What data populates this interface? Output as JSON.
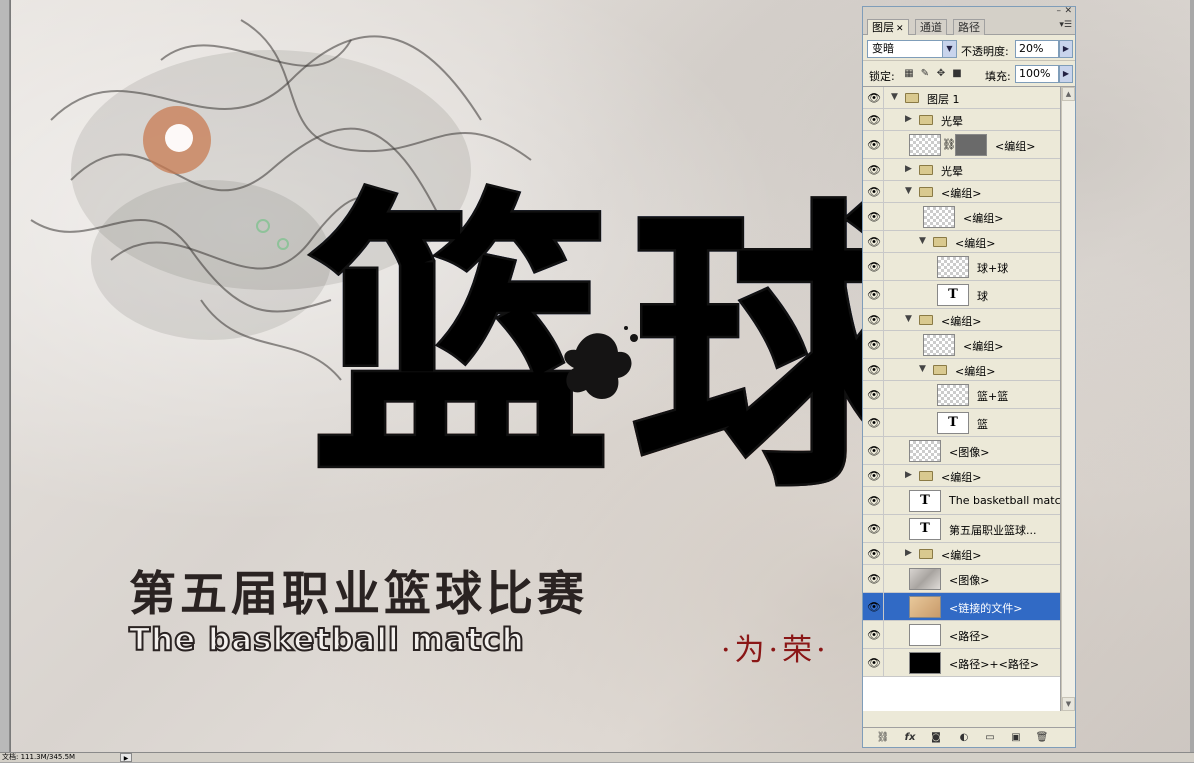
{
  "status_bar": {
    "text": "文档: 111.3M/345.5M"
  },
  "artwork": {
    "big_char_1": "篮",
    "big_char_2": "球",
    "headline_cn": "第五届职业篮球比赛",
    "headline_en": "The basketball match",
    "slogan": "·为·荣·"
  },
  "panel": {
    "tabs": [
      {
        "label": "图层"
      },
      {
        "label": "通道"
      },
      {
        "label": "路径"
      }
    ],
    "blend_mode": "变暗",
    "opacity_label": "不透明度:",
    "opacity_value": "20%",
    "lock_label": "锁定:",
    "fill_label": "填充:",
    "fill_value": "100%",
    "layers": [
      {
        "name": "图层 1",
        "kind": "group",
        "expanded": true
      },
      {
        "name": "光晕",
        "kind": "group",
        "expanded": false
      },
      {
        "name": "<编组>",
        "kind": "masked"
      },
      {
        "name": "光晕",
        "kind": "group",
        "expanded": false
      },
      {
        "name": "<编组>",
        "kind": "group",
        "expanded": true
      },
      {
        "name": "<编组>",
        "kind": "checker"
      },
      {
        "name": "<编组>",
        "kind": "group",
        "expanded": true
      },
      {
        "name": "球+球",
        "kind": "checker"
      },
      {
        "name": "球",
        "kind": "text"
      },
      {
        "name": "<编组>",
        "kind": "group",
        "expanded": true
      },
      {
        "name": "<编组>",
        "kind": "checker"
      },
      {
        "name": "<编组>",
        "kind": "group",
        "expanded": true
      },
      {
        "name": "篮+篮",
        "kind": "checker"
      },
      {
        "name": "篮",
        "kind": "text"
      },
      {
        "name": "<图像>",
        "kind": "checker"
      },
      {
        "name": "<编组>",
        "kind": "group",
        "expanded": false
      },
      {
        "name": "The basketball match",
        "kind": "text"
      },
      {
        "name": "第五届职业篮球...",
        "kind": "text"
      },
      {
        "name": "<编组>",
        "kind": "group",
        "expanded": false
      },
      {
        "name": "<图像>",
        "kind": "image"
      },
      {
        "name": "<链接的文件>",
        "kind": "linked",
        "selected": true
      },
      {
        "name": "<路径>",
        "kind": "white"
      },
      {
        "name": "<路径>+<路径>",
        "kind": "black"
      }
    ],
    "text_thumb_glyph": "T",
    "footer_icons": [
      "link-icon",
      "fx-icon",
      "mask-icon",
      "adjustment-icon",
      "new-group-icon",
      "new-layer-icon",
      "trash-icon"
    ]
  }
}
